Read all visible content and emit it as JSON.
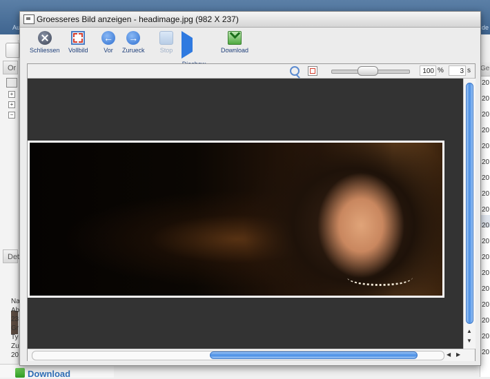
{
  "background": {
    "topbar_labels": [
      "Au",
      "de"
    ],
    "left_tab": "Or",
    "left_section": "Det",
    "left_meta": [
      "Na",
      "Ab",
      "23",
      "Gr",
      "Ty",
      "Zu",
      "20"
    ],
    "right_header": "Ge",
    "right_cells": [
      "20",
      "20",
      "20",
      "20",
      "20",
      "20",
      "20",
      "20",
      "20",
      "20",
      "20",
      "20",
      "20",
      "20",
      "20",
      "20",
      "20",
      "20"
    ],
    "download_label": "Download"
  },
  "dialog": {
    "title": "Groesseres Bild anzeigen - headimage.jpg (982 X 237)",
    "toolbar": {
      "close": "Schliessen",
      "fullscreen": "Vollbild",
      "previous": "Vor",
      "next": "Zurueck",
      "stop": "Stop",
      "slideshow": "Diashow",
      "download": "Download"
    },
    "controls": {
      "zoom_value": "100",
      "zoom_unit": "%",
      "interval_value": "3",
      "interval_unit": "s",
      "zoom_slider_fraction": 0.45
    },
    "image_alt": "headimage.jpg"
  }
}
